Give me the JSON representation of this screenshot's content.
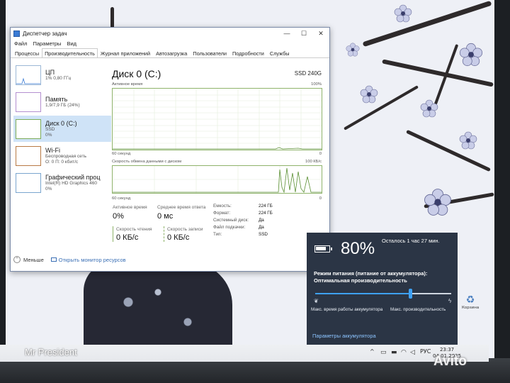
{
  "task_manager": {
    "title": "Диспетчер задач",
    "window_controls": [
      "—",
      "☐",
      "✕"
    ],
    "menu": [
      "Файл",
      "Параметры",
      "Вид"
    ],
    "tabs": [
      "Процессы",
      "Производительность",
      "Журнал приложений",
      "Автозагрузка",
      "Пользователи",
      "Подробности",
      "Службы"
    ],
    "sidebar": [
      {
        "name": "ЦП",
        "sub1": "1% 0,80 ГГц",
        "sub2": ""
      },
      {
        "name": "Память",
        "sub1": "1,9/7,9 ГБ (24%)",
        "sub2": ""
      },
      {
        "name": "Диск 0 (C:)",
        "sub1": "SSD",
        "sub2": "0%"
      },
      {
        "name": "Wi-Fi",
        "sub1": "Беспроводная сеть",
        "sub2": "О: 0 П: 0 кбит/с"
      },
      {
        "name": "Графический проц",
        "sub1": "Intel(R) HD Graphics 460",
        "sub2": "0%"
      }
    ],
    "main": {
      "title": "Диск 0 (C:)",
      "model": "SSD 240G",
      "graph1_label": "Активное время",
      "graph1_max": "100%",
      "graph1_time": "60 секунд",
      "graph1_min": "0",
      "graph2_label": "Скорость обмена данными с диском",
      "graph2_max": "100 КБ/с",
      "graph2_time": "60 секунд",
      "graph2_min": "0"
    },
    "stats": {
      "active_label": "Активное время",
      "active_value": "0%",
      "response_label": "Среднее время ответа",
      "response_value": "0 мс",
      "read_label": "Скорость чтения",
      "read_value": "0 КБ/с",
      "write_label": "Скорость записи",
      "write_value": "0 КБ/с"
    },
    "properties": [
      {
        "key": "Емкость:",
        "value": "224 ГБ"
      },
      {
        "key": "Формат:",
        "value": "224 ГБ"
      },
      {
        "key": "Системный диск:",
        "value": "Да"
      },
      {
        "key": "Файл подкачки:",
        "value": "Да"
      },
      {
        "key": "Тип:",
        "value": "SSD"
      }
    ],
    "footer": {
      "less": "Меньше",
      "resource_monitor": "Открыть монитор ресурсов"
    }
  },
  "battery": {
    "percent": "80%",
    "remaining": "Осталось 1 час 27 мин.",
    "mode_label": "Режим питания (питание от аккумулятора):",
    "mode_value": "Оптимальная производительность",
    "slider_level": 0.7,
    "slider_min": "Макс. время работы аккумулятора",
    "slider_max": "Макс. производительность",
    "settings_link": "Параметры аккумулятора"
  },
  "desktop": {
    "watermark": "Mr President",
    "recycle_label": "Корзина"
  },
  "taskbar": {
    "chevron": "^",
    "language": "РУС",
    "time": "23:37",
    "date": "04.01.2025"
  },
  "overlay": {
    "avito": "Avito"
  },
  "colors": {
    "disk_graph": "#8fb36b",
    "accent": "#3ea1f5",
    "flyout_bg": "#2b3545",
    "selection": "#cfe3f7"
  }
}
